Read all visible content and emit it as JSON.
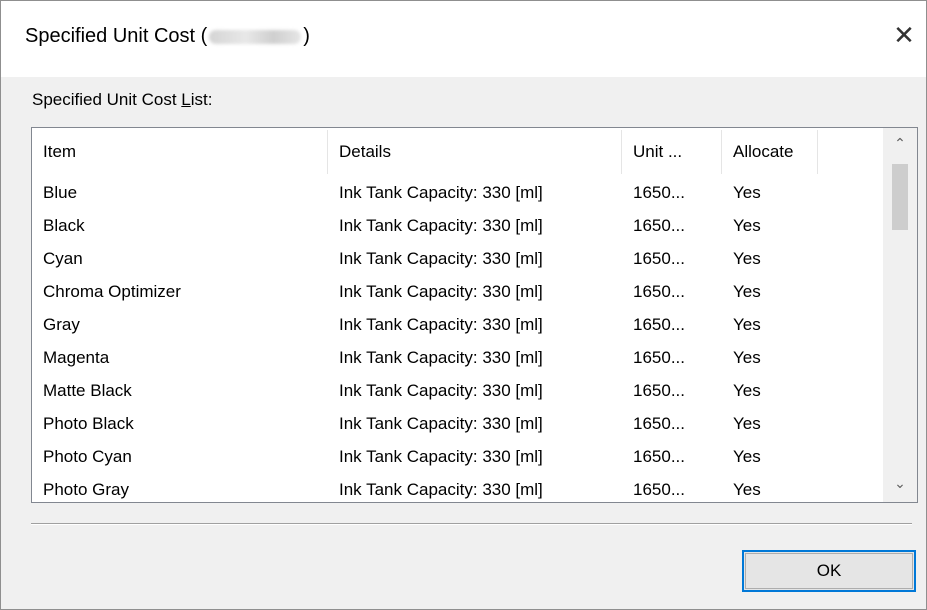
{
  "window": {
    "title_prefix": "Specified Unit Cost (",
    "title_suffix": ")",
    "close_glyph": "✕"
  },
  "list": {
    "label_before": "Specified Unit Cost ",
    "label_accel": "L",
    "label_after": "ist:",
    "columns": [
      "Item",
      "Details",
      "Unit ...",
      "Allocate"
    ],
    "rows": [
      [
        "Blue",
        "Ink Tank Capacity: 330 [ml]",
        "1650...",
        "Yes"
      ],
      [
        "Black",
        "Ink Tank Capacity: 330 [ml]",
        "1650...",
        "Yes"
      ],
      [
        "Cyan",
        "Ink Tank Capacity: 330 [ml]",
        "1650...",
        "Yes"
      ],
      [
        "Chroma Optimizer",
        "Ink Tank Capacity: 330 [ml]",
        "1650...",
        "Yes"
      ],
      [
        "Gray",
        "Ink Tank Capacity: 330 [ml]",
        "1650...",
        "Yes"
      ],
      [
        "Magenta",
        "Ink Tank Capacity: 330 [ml]",
        "1650...",
        "Yes"
      ],
      [
        "Matte Black",
        "Ink Tank Capacity: 330 [ml]",
        "1650...",
        "Yes"
      ],
      [
        "Photo Black",
        "Ink Tank Capacity: 330 [ml]",
        "1650...",
        "Yes"
      ],
      [
        "Photo Cyan",
        "Ink Tank Capacity: 330 [ml]",
        "1650...",
        "Yes"
      ],
      [
        "Photo Gray",
        "Ink Tank Capacity: 330 [ml]",
        "1650...",
        "Yes"
      ]
    ]
  },
  "scrollbar": {
    "up_glyph": "⌃",
    "down_glyph": "⌄"
  },
  "buttons": {
    "ok_label": "OK"
  },
  "colors": {
    "focus_border": "#0078d7",
    "dialog_bg": "#f0f0f0",
    "list_bg": "#ffffff"
  }
}
